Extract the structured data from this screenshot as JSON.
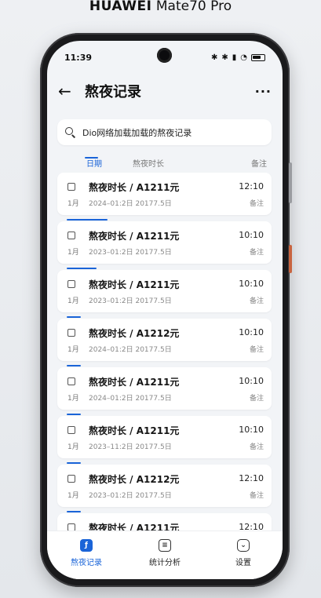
{
  "device": {
    "brand": "HUAWEI",
    "model": "Mate70 Pro"
  },
  "status_bar": {
    "time": "11:39"
  },
  "app_bar": {
    "title": "熬夜记录"
  },
  "search": {
    "value": "Dio网络加载加载的熬夜记录"
  },
  "columns": {
    "date": "日期",
    "duration": "熬夜时长",
    "note": "备注"
  },
  "records": [
    {
      "title": "熬夜时长 / A1211元",
      "time": "12:10",
      "month": "1月",
      "date": "2024–01:2日 20177.5日",
      "note": "备注"
    },
    {
      "title": "熬夜时长 / A1211元",
      "time": "10:10",
      "month": "1月",
      "date": "2023–01:2日 20177.5日",
      "note": "备注"
    },
    {
      "title": "熬夜时长 / A1211元",
      "time": "10:10",
      "month": "1月",
      "date": "2023–01:2日 20177.5日",
      "note": "备注"
    },
    {
      "title": "熬夜时长 / A1212元",
      "time": "10:10",
      "month": "1月",
      "date": "2024–01:2日 20177.5日",
      "note": "备注"
    },
    {
      "title": "熬夜时长 / A1211元",
      "time": "10:10",
      "month": "1月",
      "date": "2024–01:2日 20177.5日",
      "note": "备注"
    },
    {
      "title": "熬夜时长 / A1211元",
      "time": "10:10",
      "month": "1月",
      "date": "2023–11:2日 20177.5日",
      "note": "备注"
    },
    {
      "title": "熬夜时长 / A1212元",
      "time": "12:10",
      "month": "1月",
      "date": "2023–01:2日 20177.5日",
      "note": "备注"
    },
    {
      "title": "熬夜时长 / A1211元",
      "time": "12:10",
      "month": "",
      "date": "",
      "note": ""
    }
  ],
  "bottom_nav": [
    {
      "label": "熬夜记录",
      "icon": "night-record-icon",
      "active": true
    },
    {
      "label": "统计分析",
      "icon": "stats-icon",
      "active": false
    },
    {
      "label": "设置",
      "icon": "settings-icon",
      "active": false
    }
  ],
  "colors": {
    "accent": "#1a64d8",
    "background": "#f2f4f7",
    "card": "#ffffff"
  }
}
